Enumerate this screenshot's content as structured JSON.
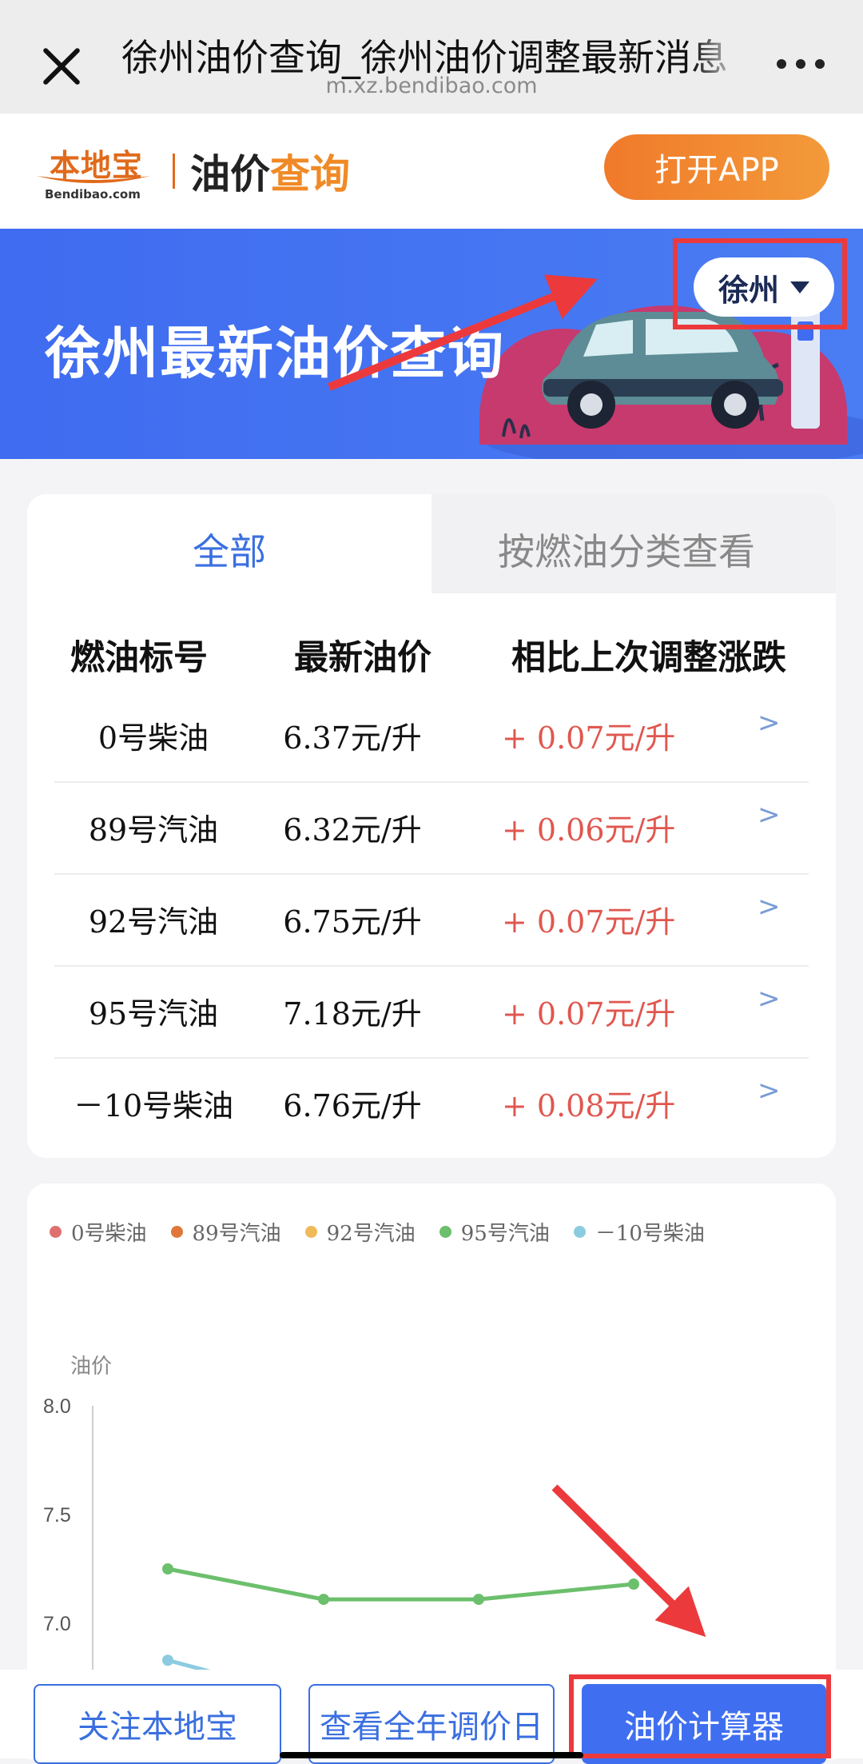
{
  "browser": {
    "title": "徐州油价查询_徐州油价调整最新消息",
    "url": "m.xz.bendibao.com"
  },
  "header": {
    "logo_text": "本地宝",
    "logo_sub": "Bendibao.com",
    "title_plain": "油价",
    "title_accent": "查询",
    "open_app": "打开APP"
  },
  "banner": {
    "title": "徐州最新油价查询",
    "city": "徐州"
  },
  "tabs": [
    {
      "label": "全部",
      "active": true
    },
    {
      "label": "按燃油分类查看",
      "active": false
    }
  ],
  "table": {
    "headers": [
      "燃油标号",
      "最新油价",
      "相比上次调整涨跌"
    ],
    "rows": [
      {
        "fuel": "0号柴油",
        "price": "6.37元/升",
        "change": "+ 0.07元/升",
        "arrow": ">"
      },
      {
        "fuel": "89号汽油",
        "price": "6.32元/升",
        "change": "+ 0.06元/升",
        "arrow": ">"
      },
      {
        "fuel": "92号汽油",
        "price": "6.75元/升",
        "change": "+ 0.07元/升",
        "arrow": ">"
      },
      {
        "fuel": "95号汽油",
        "price": "7.18元/升",
        "change": "+ 0.07元/升",
        "arrow": ">"
      },
      {
        "fuel": "－10号柴油",
        "price": "6.76元/升",
        "change": "+ 0.08元/升",
        "arrow": ">"
      }
    ]
  },
  "chart_data": {
    "type": "line",
    "ylabel": "油价",
    "ylim": [
      6.8,
      8.0
    ],
    "yticks": [
      "8.0",
      "7.5",
      "7.0"
    ],
    "legend_position": "top",
    "series": [
      {
        "name": "0号柴油",
        "color": "#e07070",
        "values": []
      },
      {
        "name": "89号汽油",
        "color": "#e0773a",
        "values": []
      },
      {
        "name": "92号汽油",
        "color": "#f0b95a",
        "values": []
      },
      {
        "name": "95号汽油",
        "color": "#6cbf6c",
        "values": [
          7.25,
          7.11,
          7.11,
          7.18
        ]
      },
      {
        "name": "－10号柴油",
        "color": "#8ccbe0",
        "values": [
          6.83
        ]
      }
    ]
  },
  "bottom": {
    "follow": "关注本地宝",
    "calendar": "查看全年调价日",
    "calculator": "油价计算器"
  },
  "colors": {
    "brand_blue": "#3f6ff0",
    "brand_orange": "#f08a26",
    "rise_red": "#e0574f",
    "annotation_red": "#ec3a3c"
  }
}
